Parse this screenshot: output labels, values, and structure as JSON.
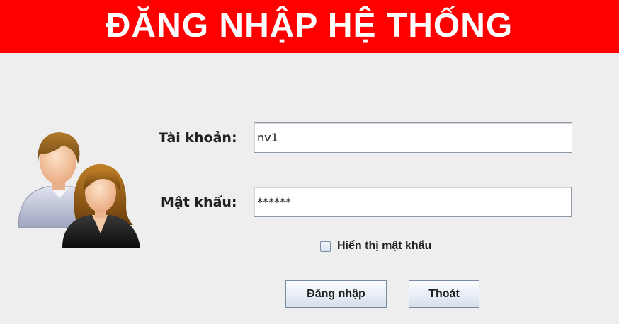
{
  "header": {
    "title": "ĐĂNG NHẬP HỆ THỐNG",
    "background": "#fe0000"
  },
  "form": {
    "username_label": "Tài khoản:",
    "username_value": "nv1",
    "password_label": "Mật khẩu:",
    "password_value": "******",
    "show_password_label": "Hiển thị mật khẩu",
    "show_password_checked": false
  },
  "buttons": {
    "login_label": "Đăng nhập",
    "exit_label": "Thoát"
  },
  "icons": {
    "avatar": "users-avatar-icon"
  }
}
